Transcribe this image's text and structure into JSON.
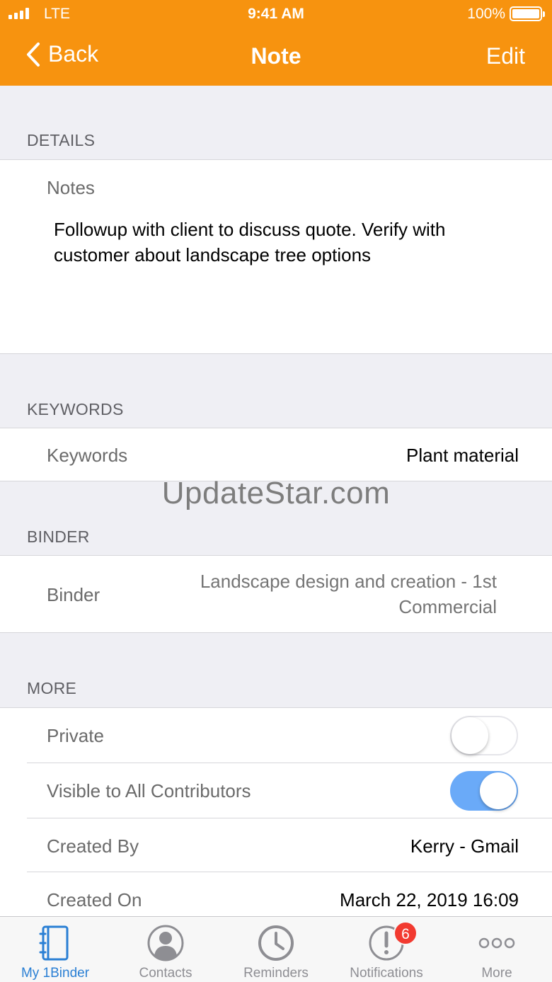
{
  "status_bar": {
    "carrier": "LTE",
    "time": "9:41 AM",
    "battery": "100%"
  },
  "nav": {
    "back_label": "Back",
    "title": "Note",
    "edit_label": "Edit"
  },
  "details": {
    "header": "DETAILS",
    "notes_label": "Notes",
    "notes_text": "Followup with client to discuss quote.  Verify with customer about landscape tree options"
  },
  "keywords": {
    "header": "KEYWORDS",
    "label": "Keywords",
    "value": "Plant material"
  },
  "watermark": "UpdateStar.com",
  "binder": {
    "header": "BINDER",
    "label": "Binder",
    "value": "Landscape design and creation - 1st Commercial"
  },
  "more": {
    "header": "MORE",
    "private_label": "Private",
    "private_on": false,
    "visible_label": "Visible to All Contributors",
    "visible_on": true,
    "created_by_label": "Created By",
    "created_by_value": "Kerry - Gmail",
    "created_on_label": "Created On",
    "created_on_value": "March 22, 2019 16:09"
  },
  "tabs": [
    {
      "label": "My 1Binder",
      "icon": "binder-icon",
      "active": true
    },
    {
      "label": "Contacts",
      "icon": "person-icon",
      "active": false
    },
    {
      "label": "Reminders",
      "icon": "clock-icon",
      "active": false
    },
    {
      "label": "Notifications",
      "icon": "alert-icon",
      "active": false,
      "badge": "6"
    },
    {
      "label": "More",
      "icon": "more-dots-icon",
      "active": false
    }
  ],
  "colors": {
    "accent": "#f7930f",
    "tab_active": "#2a7fd4",
    "toggle_on": "#6aaaf8",
    "badge": "#f23a30"
  }
}
